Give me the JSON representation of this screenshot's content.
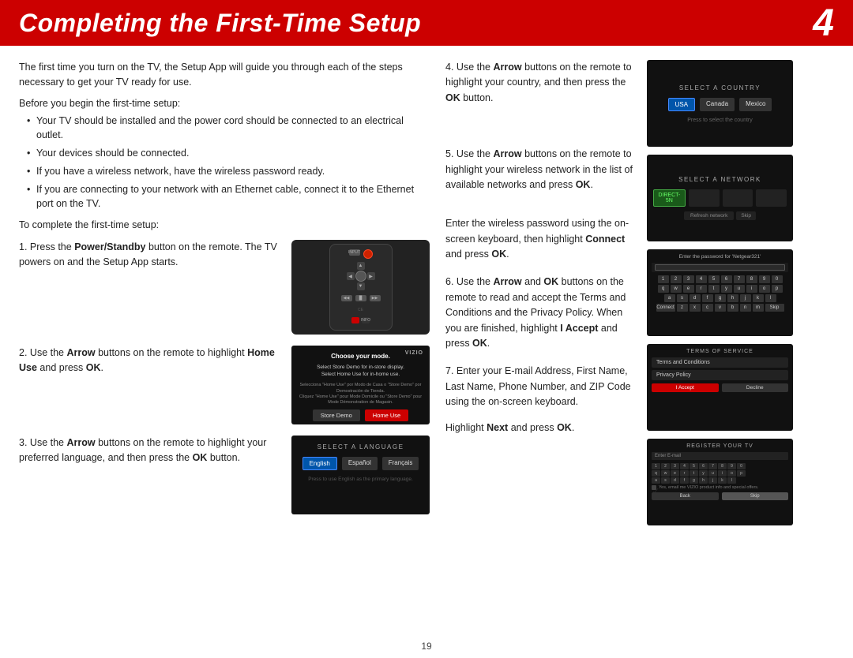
{
  "header": {
    "title": "Completing the First-Time Setup",
    "page_number": "4"
  },
  "intro": {
    "paragraph": "The first time you turn on the TV, the Setup App will guide you through each of the steps necessary to get your TV ready for use.",
    "before_setup": "Before you begin the first-time setup:",
    "bullets": [
      "Your TV should be installed and the power cord should be connected to an electrical outlet.",
      "Your devices should be connected.",
      "If you have a wireless network, have the wireless password ready.",
      "If you are connecting to your network with an Ethernet cable, connect it to the Ethernet port on the TV."
    ],
    "to_complete": "To complete the first-time setup:"
  },
  "steps": {
    "step1": {
      "number": "1.",
      "text_before": "Press the ",
      "bold1": "Power/Standby",
      "text_after": " button on the remote. The TV powers on and the Setup App starts."
    },
    "step2": {
      "number": "2.",
      "text_before": "Use the ",
      "bold1": "Arrow",
      "text_middle": " buttons on the remote to highlight ",
      "bold2": "Home Use",
      "text_after": " and press ",
      "bold3": "OK",
      "text_end": "."
    },
    "step3": {
      "number": "3.",
      "text_before": "Use the ",
      "bold1": "Arrow",
      "text_middle": " buttons on the remote to highlight your preferred language, and then press the ",
      "bold2": "OK",
      "text_after": " button."
    },
    "step4": {
      "number": "4.",
      "text_before": "Use the ",
      "bold1": "Arrow",
      "text_middle": " buttons on the remote to highlight your country, and then press the ",
      "bold2": "OK",
      "text_after": " button."
    },
    "step5": {
      "number": "5.",
      "text_before": "Use the ",
      "bold1": "Arrow",
      "text_middle": " buttons on the remote to highlight your wireless network in the list of available networks and press ",
      "bold2": "OK",
      "text_after": "."
    },
    "step5b": {
      "text": "Enter the wireless password using the on-screen keyboard, then highlight ",
      "bold1": "Connect",
      "text_after": " and press ",
      "bold2": "OK",
      "text_end": "."
    },
    "step6": {
      "number": "6.",
      "text_before": "Use the ",
      "bold1": "Arrow",
      "text_middle": " and ",
      "bold2": "OK",
      "text_after": " buttons on the remote to read and accept the Terms and Conditions and the Privacy Policy. When you are finished, highlight ",
      "bold3": "I Accept",
      "text_end": " and press ",
      "bold4": "OK",
      "text_final": "."
    },
    "step7": {
      "number": "7.",
      "text": "Enter your E-mail Address, First Name, Last Name, Phone Number, and ZIP Code using the on-screen keyboard."
    },
    "step7b": {
      "text_before": "Highlight ",
      "bold1": "Next",
      "text_middle": " and press ",
      "bold2": "OK",
      "text_after": "."
    }
  },
  "screens": {
    "select_country": {
      "title": "SELECT A COUNTRY",
      "options": [
        "USA",
        "Canada",
        "Mexico"
      ],
      "subtitle": "Press  to select the country"
    },
    "select_network": {
      "title": "SELECT A NETWORK",
      "options": [
        "DIRECT-5N",
        "",
        "",
        ""
      ]
    },
    "password": {
      "title": "Enter the password for 'Netgear321'"
    },
    "terms": {
      "title": "TERMS OF SERVICE",
      "items": [
        "Terms and Conditions",
        "Privacy Policy"
      ],
      "accept": "I Accept",
      "cancel": "Decline"
    },
    "register": {
      "title": "REGISTER YOUR TV",
      "field": "Enter E-mail"
    },
    "home_use": {
      "title": "Choose your mode.",
      "subtitle": "Select Store Demo for in-store display.",
      "line2": "Select Home Use for in-home use.",
      "btn1": "Store Demo",
      "btn2": "Home Use"
    },
    "language": {
      "title": "SELECT A LANGUAGE",
      "options": [
        "English",
        "Español",
        "Français"
      ],
      "subtitle": "Press  to use English as the primary language."
    }
  },
  "footer": {
    "page_number": "19"
  }
}
